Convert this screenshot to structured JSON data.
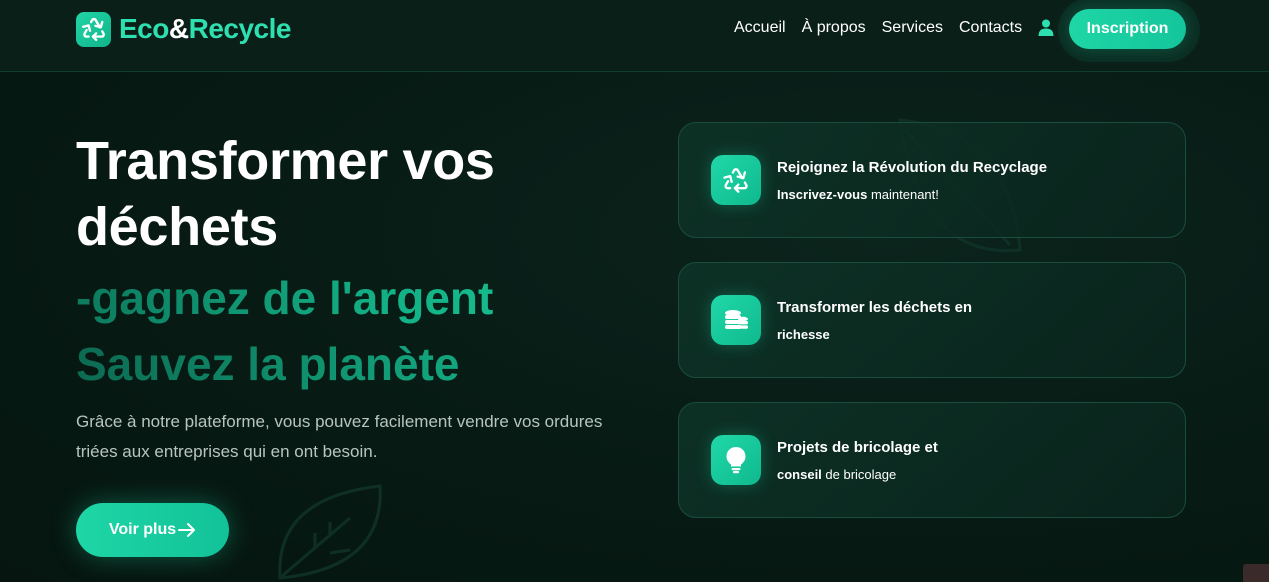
{
  "brand": {
    "name_part1": "Eco",
    "name_amp": "&",
    "name_part2": "Recycle",
    "icon": "recycle-icon",
    "color": "#2ee0b0"
  },
  "nav": {
    "links": [
      "Accueil",
      "À propos",
      "Services",
      "Contacts"
    ],
    "user_icon": "user-icon",
    "signup_label": "Inscription"
  },
  "hero": {
    "title": "Transformer vos déchets",
    "accent_line1": "-gagnez de l'argent",
    "accent_line2": "Sauvez la planète",
    "description": "Grâce à notre plateforme, vous pouvez facilement vendre vos ordures triées aux entreprises qui en ont besoin.",
    "cta_label": "Voir plus",
    "cta_icon": "arrow-right-icon"
  },
  "cards": [
    {
      "icon": "recycle-icon",
      "title": "Rejoignez la Révolution du Recyclage",
      "sub_bold": "Inscrivez-vous",
      "sub_rest": " maintenant!"
    },
    {
      "icon": "coins-icon",
      "title": "Transformer les déchets en",
      "sub_bold": "richesse",
      "sub_rest": ""
    },
    {
      "icon": "lightbulb-icon",
      "title": "Projets de bricolage et",
      "sub_bold": "conseil",
      "sub_rest": " de bricolage"
    }
  ],
  "colors": {
    "accent": "#1ed6a6",
    "background": "#071a14",
    "navbar": "#0b1f19",
    "card_border": "#1a4d3d"
  }
}
